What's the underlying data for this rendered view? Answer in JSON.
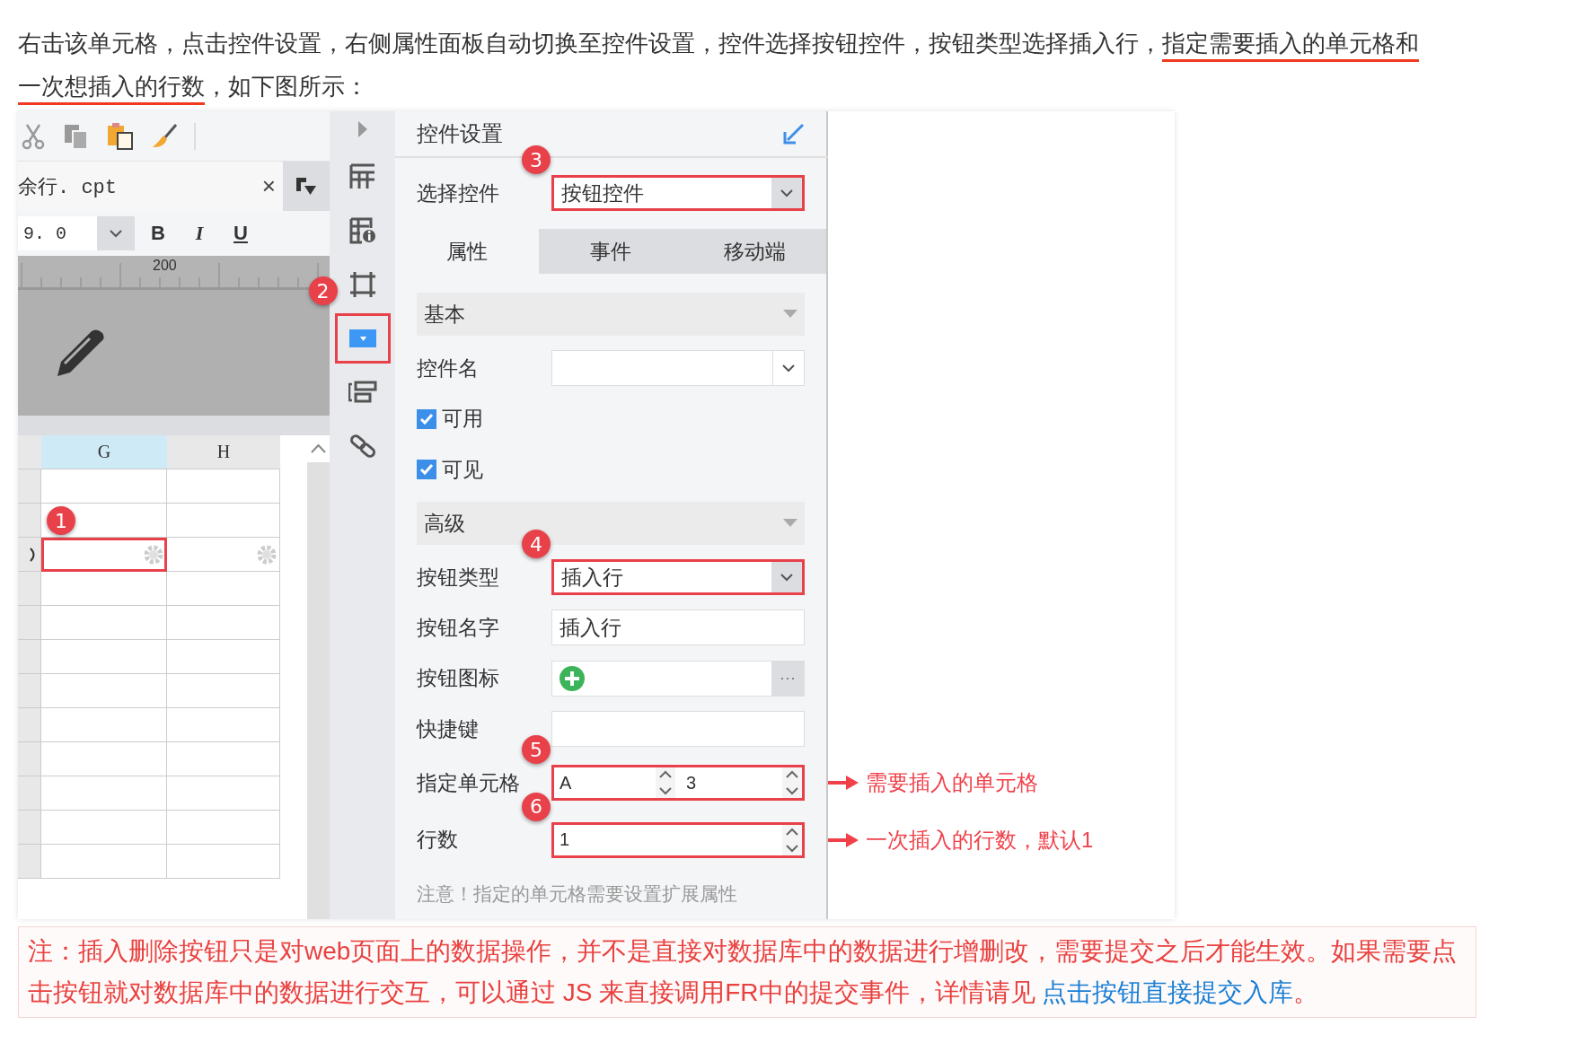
{
  "intro": {
    "text": "右击该单元格，点击控件设置，右侧属性面板自动切换至控件设置，控件选择按钮控件，按钮类型选择插入行，",
    "underlined": "指定需要插入的单元格和一次想插入的行数",
    "tail": "，如下图所示："
  },
  "editor": {
    "file_tab": "余行. cpt",
    "close": "×",
    "font_size": "9. 0",
    "format_buttons": [
      "B",
      "I",
      "U"
    ],
    "ruler_label": "200",
    "columns": [
      {
        "label": "G",
        "selected": true
      },
      {
        "label": "H",
        "selected": false
      }
    ],
    "cell_badge": "1"
  },
  "strip": [
    {
      "kind": "grid"
    },
    {
      "kind": "info-grid"
    },
    {
      "kind": "frame"
    },
    {
      "kind": "dropdown",
      "badge": "2"
    },
    {
      "kind": "list"
    },
    {
      "kind": "link"
    }
  ],
  "panel": {
    "title": "控件设置",
    "select_label": "选择控件",
    "select_value": "按钮控件",
    "select_badge": "3",
    "tabs": [
      {
        "label": "属性",
        "selected": true
      },
      {
        "label": "事件",
        "selected": false
      },
      {
        "label": "移动端",
        "selected": false
      }
    ],
    "rows": [
      {
        "kind": "section",
        "label": "基本"
      },
      {
        "kind": "combo",
        "label": "控件名"
      },
      {
        "kind": "checkbox",
        "label": "可用",
        "checked": true
      },
      {
        "kind": "checkbox",
        "label": "可见",
        "checked": true
      },
      {
        "kind": "section",
        "label": "高级"
      },
      {
        "kind": "combo",
        "label": "按钮类型",
        "value": "插入行",
        "badge": "4"
      },
      {
        "kind": "text",
        "label": "按钮名字",
        "value": "插入行"
      },
      {
        "kind": "icon",
        "label": "按钮图标",
        "button": "···"
      },
      {
        "kind": "text",
        "label": "快捷键"
      },
      {
        "kind": "spinner-pair",
        "label": "指定单元格",
        "values": [
          "A",
          "3"
        ],
        "badge": "5",
        "note": "需要插入的单元格"
      },
      {
        "kind": "spinner",
        "label": "行数",
        "value": "1",
        "badge": "6",
        "note": "一次插入的行数，默认1"
      },
      {
        "kind": "hint",
        "label": "注意！指定的单元格需要设置扩展属性"
      }
    ]
  },
  "note": {
    "text": "注：插入删除按钮只是对web页面上的数据操作，并不是直接对数据库中的数据进行增删改，需要提交之后才能生效。如果需要点击按钮就对数据库中的数据进行交互，可以通过 JS 来直接调用FR中的提交事件，详情请见 ",
    "link": "点击按钮直接提交入库",
    "tail": "。"
  }
}
